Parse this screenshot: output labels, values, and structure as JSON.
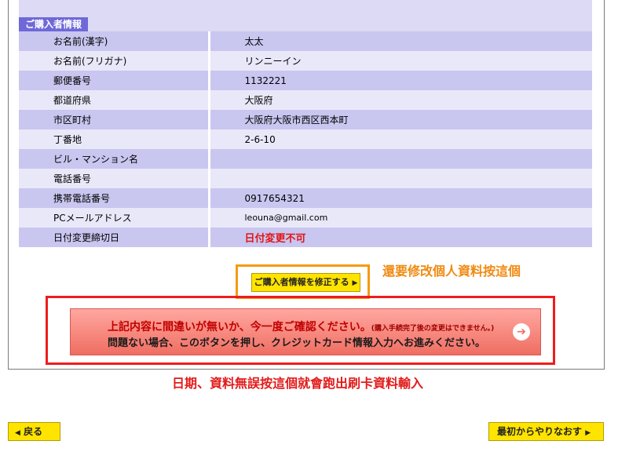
{
  "section_tab": "ご購入者情報",
  "rows": [
    {
      "label": "お名前(漢字)",
      "value": "太太"
    },
    {
      "label": "お名前(フリガナ)",
      "value": "リンニーイン"
    },
    {
      "label": "郵便番号",
      "value": "1132221"
    },
    {
      "label": "都道府県",
      "value": "大阪府"
    },
    {
      "label": "市区町村",
      "value": "大阪府大阪市西区西本町"
    },
    {
      "label": "丁番地",
      "value": "2-6-10"
    },
    {
      "label": "ビル・マンション名",
      "value": ""
    },
    {
      "label": "電話番号",
      "value": ""
    },
    {
      "label": "携帯電話番号",
      "value": "0917654321"
    },
    {
      "label": "PCメールアドレス",
      "value": "leouna@gmail.com"
    },
    {
      "label": "日付変更締切日",
      "value": "日付変更不可"
    }
  ],
  "edit_button_label": "ご購入者情報を修正する",
  "annotation_edit": "還要修改個人資料按這個",
  "confirm": {
    "line1_main": "上記内容に間違いが無いか、今一度ご確認ください。",
    "line1_small": "(購入手続完了後の変更はできません。)",
    "line2": "問題ない場合、このボタンを押し、クレジットカード情報入力へお進みください。"
  },
  "annotation_confirm": "日期、資料無誤按這個就會跑出刷卡資料輸入",
  "back_label": "戻る",
  "restart_label": "最初からやりなおす",
  "icons": {
    "arrow_left": "◀",
    "arrow_right": "▶",
    "circle_arrow": "➔"
  }
}
